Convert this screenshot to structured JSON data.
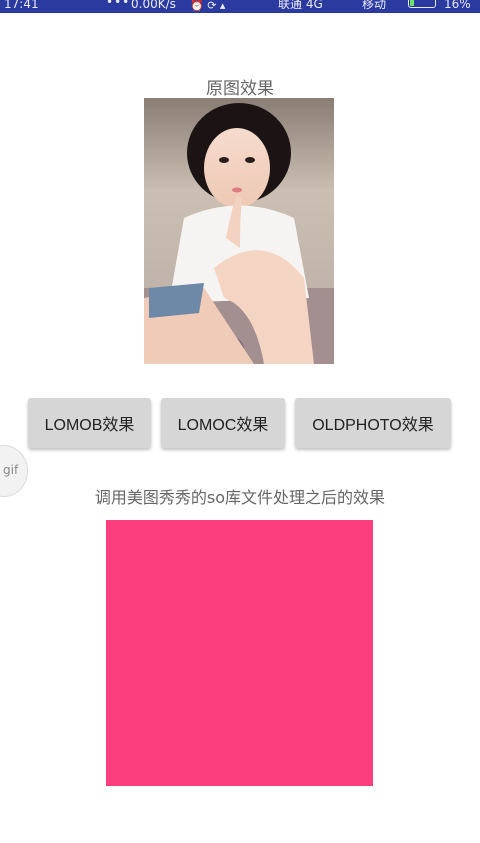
{
  "status_bar": {
    "time": "17:41",
    "dots": "•••",
    "net_speed": "0.00K/s",
    "carrier1": "联通 4G",
    "carrier2": "移动",
    "battery_percent": "16%",
    "battery_level": 0.16,
    "icon_names": [
      "alarm-icon",
      "sync-icon",
      "signal-icon",
      "signal-icon"
    ]
  },
  "main": {
    "original_label": "原图效果",
    "result_label": "调用美图秀秀的so库文件处理之后的效果"
  },
  "buttons": {
    "lomob": "LOMOB效果",
    "lomoc": "LOMOC效果",
    "oldphoto": "OLDPHOTO效果"
  },
  "gif_badge": "gif",
  "colors": {
    "status_bar": "#2b3a9e",
    "button_bg": "#d6d6d6",
    "result_fill": "#fd3e7e"
  }
}
